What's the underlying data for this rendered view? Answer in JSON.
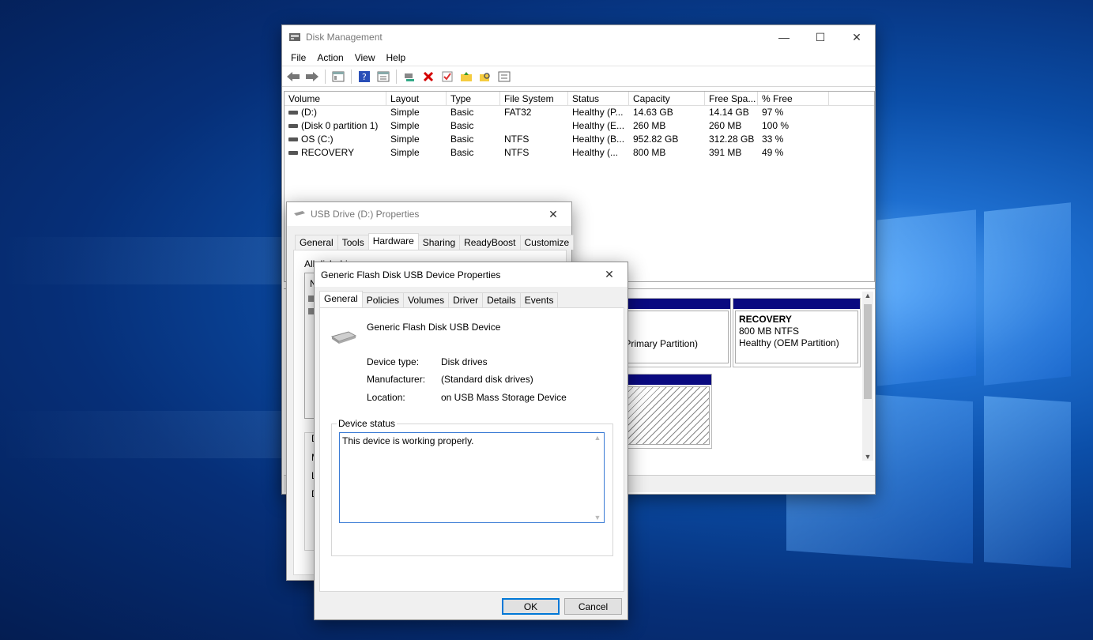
{
  "disk_management": {
    "title": "Disk Management",
    "menu": [
      "File",
      "Action",
      "View",
      "Help"
    ],
    "toolbar_icons": [
      "back-arrow-icon",
      "forward-arrow-icon",
      "console-tree-icon",
      "help-icon",
      "properties-icon",
      "connect-icon",
      "delete-icon",
      "check-icon",
      "open-folder-icon",
      "search-icon",
      "list-icon"
    ],
    "columns": [
      "Volume",
      "Layout",
      "Type",
      "File System",
      "Status",
      "Capacity",
      "Free Spa...",
      "% Free"
    ],
    "rows": [
      {
        "volume": "(D:)",
        "layout": "Simple",
        "type": "Basic",
        "fs": "FAT32",
        "status": "Healthy (P...",
        "capacity": "14.63 GB",
        "free": "14.14 GB",
        "pct": "97 %"
      },
      {
        "volume": "(Disk 0 partition 1)",
        "layout": "Simple",
        "type": "Basic",
        "fs": "",
        "status": "Healthy (E...",
        "capacity": "260 MB",
        "free": "260 MB",
        "pct": "100 %"
      },
      {
        "volume": "OS (C:)",
        "layout": "Simple",
        "type": "Basic",
        "fs": "NTFS",
        "status": "Healthy (B...",
        "capacity": "952.82 GB",
        "free": "312.28 GB",
        "pct": "33 %"
      },
      {
        "volume": "RECOVERY",
        "layout": "Simple",
        "type": "Basic",
        "fs": "NTFS",
        "status": "Healthy (...",
        "capacity": "800 MB",
        "free": "391 MB",
        "pct": "49 %"
      }
    ],
    "graphical": {
      "partial_text": "p, Primary Partition)",
      "recovery_name": "RECOVERY",
      "recovery_size": "800 MB NTFS",
      "recovery_status": "Healthy (OEM Partition)"
    }
  },
  "usb_properties": {
    "title": "USB Drive (D:) Properties",
    "tabs": [
      "General",
      "Tools",
      "Hardware",
      "Sharing",
      "ReadyBoost",
      "Customize"
    ],
    "selected_tab": "Hardware",
    "label_all_drives": "All disk drives:",
    "partial_letters": [
      "N",
      "D",
      "M",
      "L",
      "D"
    ]
  },
  "device_properties": {
    "title": "Generic Flash Disk USB Device Properties",
    "tabs": [
      "General",
      "Policies",
      "Volumes",
      "Driver",
      "Details",
      "Events"
    ],
    "selected_tab": "General",
    "device_name": "Generic Flash Disk USB Device",
    "device_type_label": "Device type:",
    "device_type": "Disk drives",
    "manufacturer_label": "Manufacturer:",
    "manufacturer": "(Standard disk drives)",
    "location_label": "Location:",
    "location": "on USB Mass Storage Device",
    "status_group": "Device status",
    "status_text": "This device is working properly.",
    "ok": "OK",
    "cancel": "Cancel"
  }
}
